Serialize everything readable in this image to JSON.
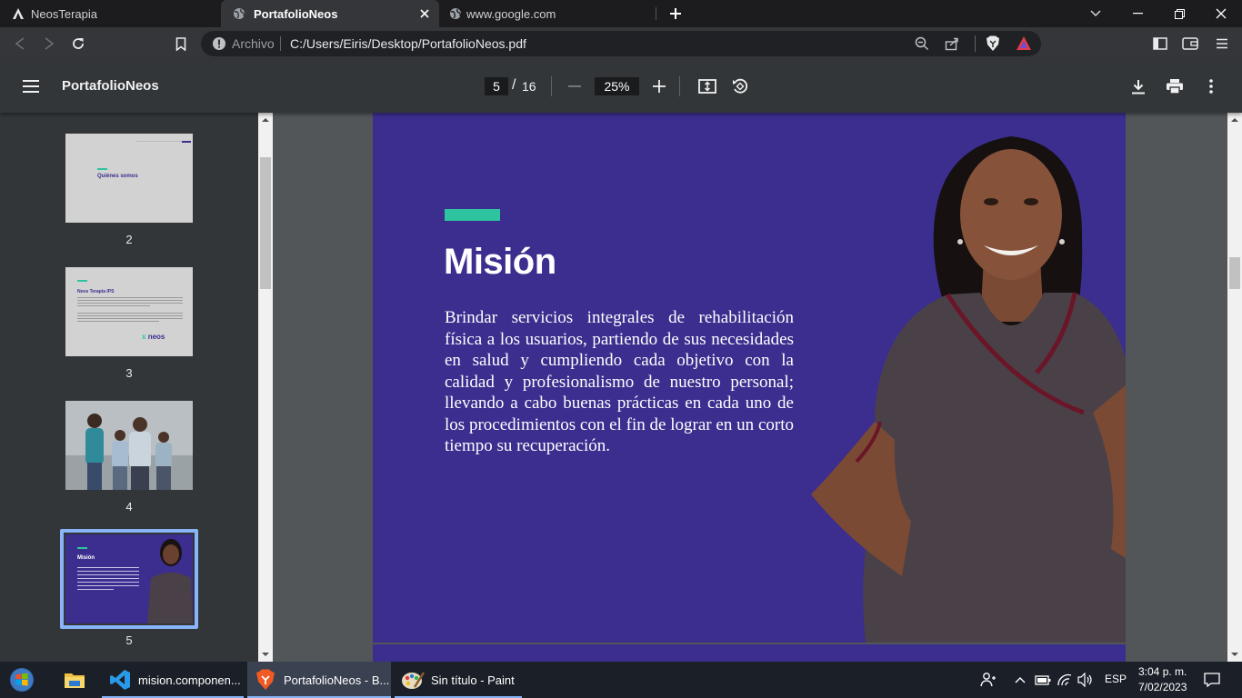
{
  "tabs": [
    {
      "title": "NeosTerapia",
      "favicon": "brave-a-icon",
      "active": false
    },
    {
      "title": "PortafolioNeos",
      "favicon": "globe-icon",
      "active": true
    },
    {
      "title": "www.google.com",
      "favicon": "globe-icon",
      "active": false
    }
  ],
  "address": {
    "scheme_label": "Archivo",
    "url": "C:/Users/Eiris/Desktop/PortafolioNeos.pdf"
  },
  "pdf": {
    "title": "PortafolioNeos",
    "current_page": "5",
    "separator": "/",
    "total_pages": "16",
    "zoom": "25%"
  },
  "thumbnails": [
    {
      "num": "2",
      "heading": "Quiénes somos"
    },
    {
      "num": "3",
      "heading": "Neos Terapia IPS",
      "logo": "neos"
    },
    {
      "num": "4"
    },
    {
      "num": "5",
      "heading": "Misión",
      "selected": true
    }
  ],
  "slide": {
    "title": "Misión",
    "body": "Brindar servicios integrales de rehabilitación física a los usuarios, partiendo de sus necesidades en salud y cumpliendo cada objetivo con la calidad y profesionalismo de nuestro personal; llevando a cabo buenas prácticas en cada uno de los procedimientos con el fin de lograr en un corto tiempo su recuperación.",
    "accent_color": "#2ec4a0",
    "background_color": "#3b2e8f"
  },
  "taskbar": {
    "apps": [
      {
        "label": "",
        "icon": "windows-start-icon"
      },
      {
        "label": "",
        "icon": "file-explorer-icon"
      },
      {
        "label": "mision.componen...",
        "icon": "vscode-icon"
      },
      {
        "label": "PortafolioNeos - B...",
        "icon": "brave-icon"
      },
      {
        "label": "Sin título - Paint",
        "icon": "paint-icon"
      }
    ],
    "language": "ESP",
    "time": "3:04 p. m.",
    "date": "7/02/2023"
  }
}
